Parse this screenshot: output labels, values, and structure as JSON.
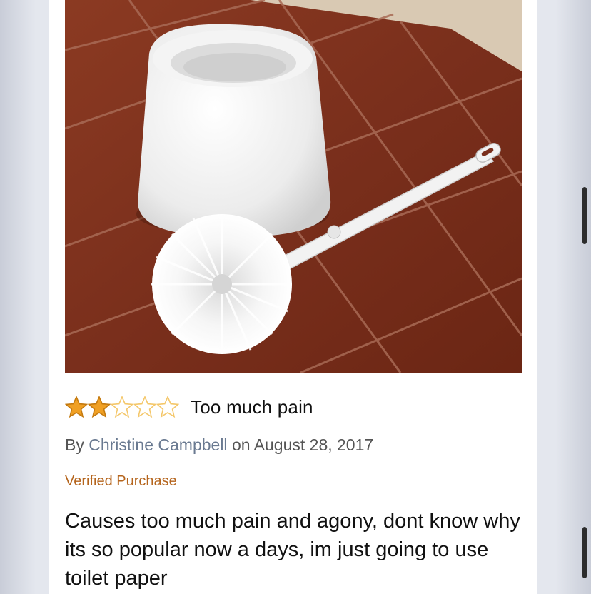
{
  "product_image": {
    "alt": "toilet brush and holder on tile floor",
    "colors": {
      "floor": "#7a2f1c",
      "grout": "#a86a55",
      "ceramic": "#f1f1f1"
    }
  },
  "review": {
    "rating": 2,
    "max_rating": 5,
    "title": "Too much pain",
    "by_label": "By",
    "author": "Christine Campbell",
    "on_label": "on",
    "date": "August 28, 2017",
    "verified_label": "Verified Purchase",
    "body": "Causes too much pain and agony, dont know why its so popular now a days, im just going to use toilet paper",
    "colors": {
      "star_filled": "#f0a024",
      "star_empty": "#f4c76a",
      "author_link": "#6a7a91",
      "verified": "#b5651d"
    }
  },
  "icons": {
    "star_filled": "star-filled-icon",
    "star_empty": "star-outline-icon"
  }
}
